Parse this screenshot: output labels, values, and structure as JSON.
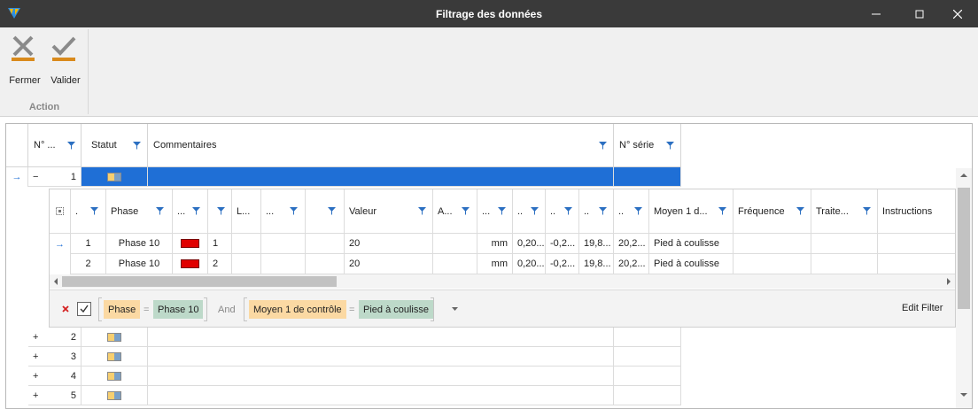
{
  "window": {
    "title": "Filtrage des données"
  },
  "ribbon": {
    "close_label": "Fermer",
    "validate_label": "Valider",
    "group_label": "Action"
  },
  "grid": {
    "columns": {
      "num": "N° ...",
      "status": "Statut",
      "comments": "Commentaires",
      "serial": "N° série"
    },
    "expanded_row": {
      "toggle": "−",
      "num": "1"
    },
    "collapsed_rows": [
      {
        "toggle": "+",
        "num": "2"
      },
      {
        "toggle": "+",
        "num": "3"
      },
      {
        "toggle": "+",
        "num": "4"
      },
      {
        "toggle": "+",
        "num": "5"
      }
    ]
  },
  "detail": {
    "columns": {
      "dot": ".",
      "phase": "Phase",
      "c3": "...",
      "c5": "L...",
      "c6": "...",
      "valeur": "Valeur",
      "a": "A...",
      "c9": "...",
      "c10": "..",
      "c11": "..",
      "c12": "..",
      "c13": "..",
      "moyen": "Moyen 1 d...",
      "frequence": "Fréquence",
      "traite": "Traite...",
      "instructions": "Instructions"
    },
    "rows": [
      {
        "n": "1",
        "phase": "Phase 10",
        "idx": "1",
        "valeur": "20",
        "unit": "mm",
        "v1": "0,20...",
        "v2": "-0,2...",
        "v3": "19,8...",
        "v4": "20,2...",
        "moyen": "Pied à coulisse"
      },
      {
        "n": "2",
        "phase": "Phase 10",
        "idx": "2",
        "valeur": "20",
        "unit": "mm",
        "v1": "0,20...",
        "v2": "-0,2...",
        "v3": "19,8...",
        "v4": "20,2...",
        "moyen": "Pied à coulisse"
      }
    ],
    "filter": {
      "field1": "Phase",
      "op1": "=",
      "value1": "Phase 10",
      "conj": "And",
      "field2": "Moyen 1 de contrôle",
      "op2": "=",
      "value2": "Pied à coulisse",
      "edit_label": "Edit Filter",
      "enabled": true
    }
  },
  "colors": {
    "titlebar": "#3a3a3a",
    "selection": "#1f6fd6",
    "filter_icon": "#2b6fc1",
    "accent": "#d98a1c",
    "red_marker": "#e00000"
  }
}
